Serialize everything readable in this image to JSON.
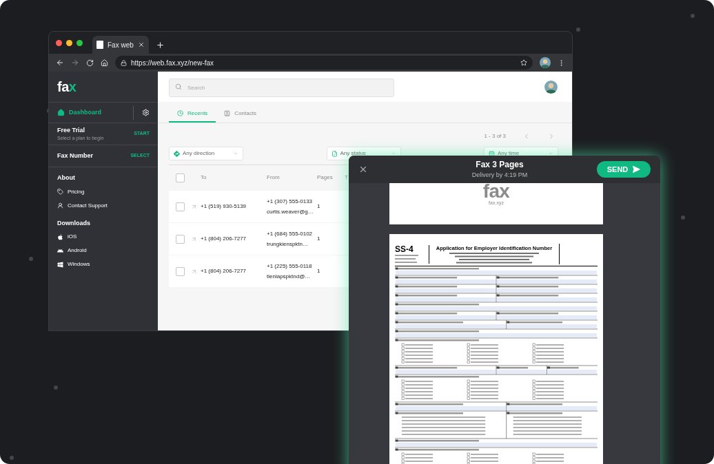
{
  "browser": {
    "tab_title": "Fax web",
    "url": "https://web.fax.xyz/new-fax"
  },
  "sidebar": {
    "logo": [
      "fa",
      "x"
    ],
    "nav": [
      {
        "label": "Dashboard",
        "selected": true
      }
    ],
    "plans": [
      {
        "title": "Free Trial",
        "subtitle": "Select a plan to begin",
        "action": "START"
      },
      {
        "title": "Fax Number",
        "action": "SELECT"
      }
    ],
    "sections": [
      {
        "heading": "About",
        "items": [
          {
            "label": "Pricing",
            "kind": "tag"
          },
          {
            "label": "Contact Support",
            "kind": "person"
          }
        ]
      },
      {
        "heading": "Downloads",
        "items": [
          {
            "label": "iOS",
            "kind": "apple"
          },
          {
            "label": "Android",
            "kind": "android"
          },
          {
            "label": "Windows",
            "kind": "windows"
          }
        ]
      }
    ]
  },
  "search": {
    "placeholder": "Search"
  },
  "tabs": [
    {
      "label": "Recents",
      "kind": "clock",
      "selected": true
    },
    {
      "label": "Contacts",
      "kind": "contact",
      "selected": false
    }
  ],
  "pagination": "1 - 3 of 3",
  "filters": [
    {
      "label": "Any direction",
      "kind": "direction"
    },
    {
      "label": "Any status",
      "kind": "status"
    },
    {
      "label": "Any time",
      "kind": "time"
    }
  ],
  "table": {
    "header_checked": false,
    "columns": [
      "To",
      "From",
      "Pages",
      "T"
    ],
    "rows": [
      {
        "checked": false,
        "to": "+1 (519) 930-5139",
        "from": "+1 (307) 555-0133",
        "email": "curtis.weaver@g…",
        "pages": "1"
      },
      {
        "checked": false,
        "to": "+1 (804) 206-7277",
        "from": "+1 (684) 555-0102",
        "email": "trungkienspktn…",
        "pages": "1"
      },
      {
        "checked": false,
        "to": "+1 (804) 206-7277",
        "from": "+1 (225) 555-0118",
        "email": "tienlapspktnd@…",
        "pages": "1"
      }
    ]
  },
  "modal": {
    "title": "Fax 3 Pages",
    "subtitle": "Delivery by 4:19 PM",
    "send": "SEND",
    "cover": {
      "logo": "fax",
      "site": "fax.xyz"
    },
    "form": {
      "number": "SS-4",
      "title": "Application for Employer Identification Number"
    }
  }
}
